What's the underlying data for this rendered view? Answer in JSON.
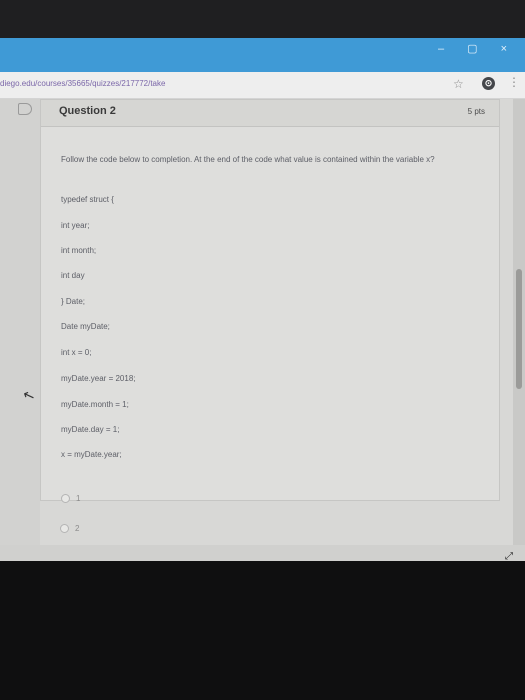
{
  "browser": {
    "url": "diego.edu/courses/35665/quizzes/217772/take",
    "window_controls": "– ▢ ×"
  },
  "question": {
    "title": "Question 2",
    "points": "5 pts",
    "prompt": "Follow the code below to completion. At the end of the code what value is contained within the variable x?",
    "code": [
      "typedef struct {",
      "int year;",
      "int month;",
      "int day",
      "} Date;",
      "Date myDate;",
      "int x = 0;",
      "myDate.year = 2018;",
      "myDate.month = 1;",
      "myDate.day = 1;",
      "x = myDate.year;"
    ],
    "options": [
      "1",
      "2"
    ]
  }
}
